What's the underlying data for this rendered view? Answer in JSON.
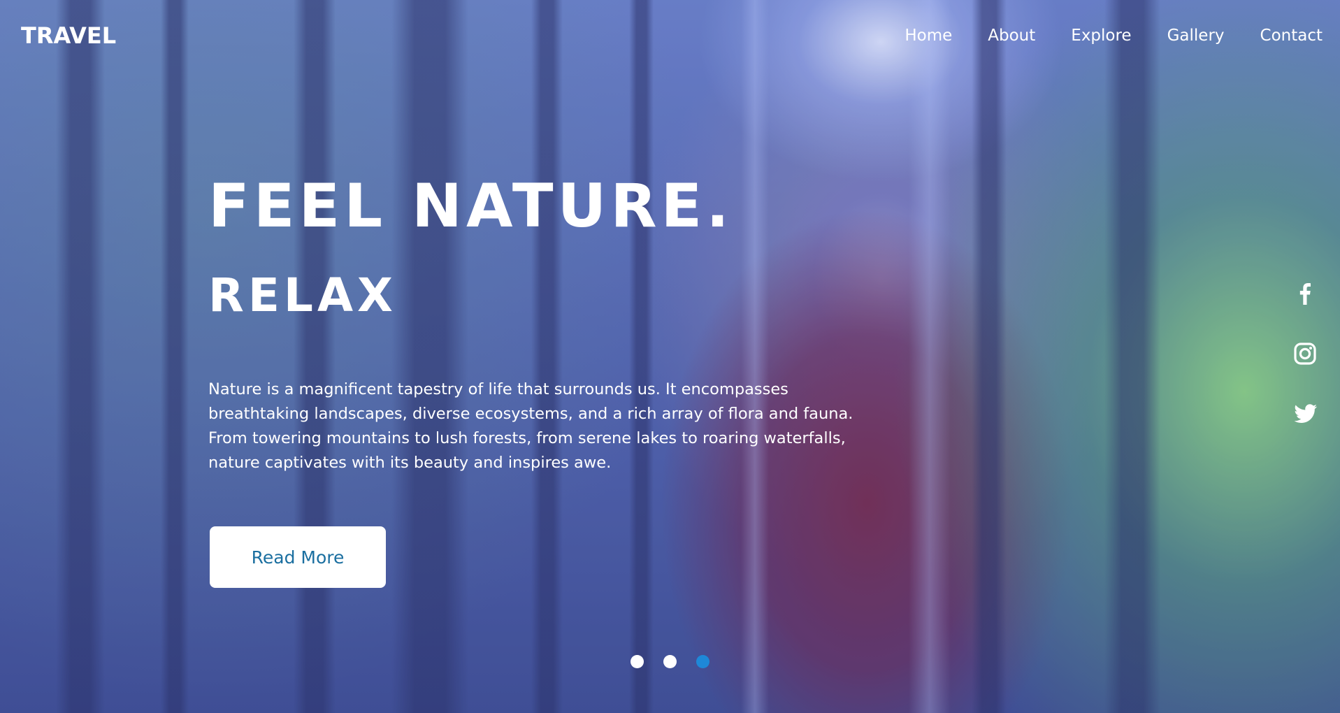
{
  "header": {
    "logo": "TRAVEL",
    "nav": [
      "Home",
      "About",
      "Explore",
      "Gallery",
      "Contact"
    ]
  },
  "hero": {
    "title": "FEEL NATURE.",
    "subtitle": "RELAX",
    "description": "Nature is a magnificent tapestry of life that surrounds us. It encompasses breathtaking landscapes, diverse ecosystems, and a rich array of flora and fauna. From towering mountains to lush forests, from serene lakes to roaring waterfalls, nature captivates with its beauty and inspires awe.",
    "button_label": "Read More"
  },
  "social": [
    "facebook-icon",
    "instagram-icon",
    "twitter-icon"
  ],
  "slider": {
    "count": 3,
    "active_index": 2
  },
  "colors": {
    "button_text": "#1b6fa0",
    "active_dot": "#1e88d8",
    "text": "#ffffff"
  }
}
